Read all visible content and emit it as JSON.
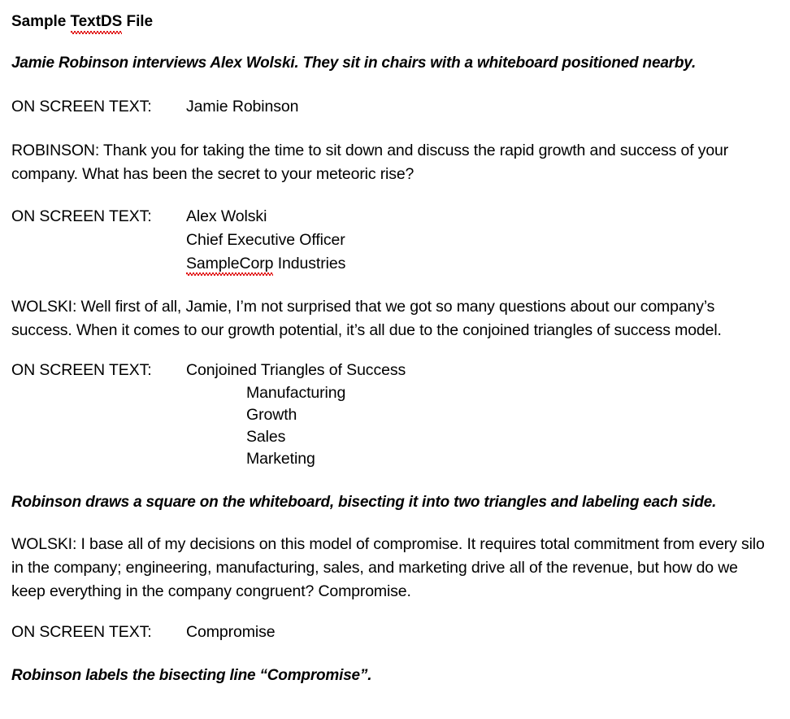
{
  "document": {
    "title": "Sample TextDS File",
    "title_parts": {
      "before": "Sample ",
      "misspelled": "TextDS",
      "after": " File"
    },
    "spellcheck_color": "#e01010",
    "blocks": [
      {
        "type": "stage-direction",
        "text": "Jamie Robinson interviews Alex Wolski. They sit in chairs with a whiteboard positioned nearby."
      },
      {
        "type": "on-screen-text",
        "label": "ON SCREEN TEXT:",
        "value": "Jamie Robinson"
      },
      {
        "type": "dialogue",
        "text": "ROBINSON: Thank you for taking the time to sit down and discuss the rapid growth and success of your company. What has been the secret to your meteoric rise?"
      },
      {
        "type": "on-screen-text",
        "label": "ON SCREEN TEXT:",
        "value": "Alex Wolski",
        "value_lines": [
          "Alex Wolski",
          "Chief Executive Officer",
          "SampleCorp Industries"
        ],
        "misspelled_line_index": 2,
        "misspelled_word": "SampleCorp",
        "misspelled_rest": " Industries"
      },
      {
        "type": "dialogue",
        "text": "WOLSKI: Well first of all, Jamie, I’m not surprised that we got so many questions about our company’s success. When it comes to our growth potential, it’s all due to the conjoined triangles of success model."
      },
      {
        "type": "on-screen-text",
        "label": "ON SCREEN TEXT:",
        "value": "Conjoined Triangles of Success",
        "sub_items": [
          "Manufacturing",
          "Growth",
          "Sales",
          "Marketing"
        ]
      },
      {
        "type": "stage-direction",
        "text": "Robinson draws a square on the whiteboard, bisecting it into two triangles and labeling each side."
      },
      {
        "type": "dialogue",
        "text": "WOLSKI: I base all of my decisions on this model of compromise. It requires total commitment from every silo in the company; engineering, manufacturing, sales, and marketing drive all of the revenue, but how do we keep everything in the company congruent? Compromise."
      },
      {
        "type": "on-screen-text",
        "label": "ON SCREEN TEXT:",
        "value": "Compromise"
      },
      {
        "type": "stage-direction",
        "text": "Robinson labels the bisecting line “Compromise”."
      }
    ]
  }
}
